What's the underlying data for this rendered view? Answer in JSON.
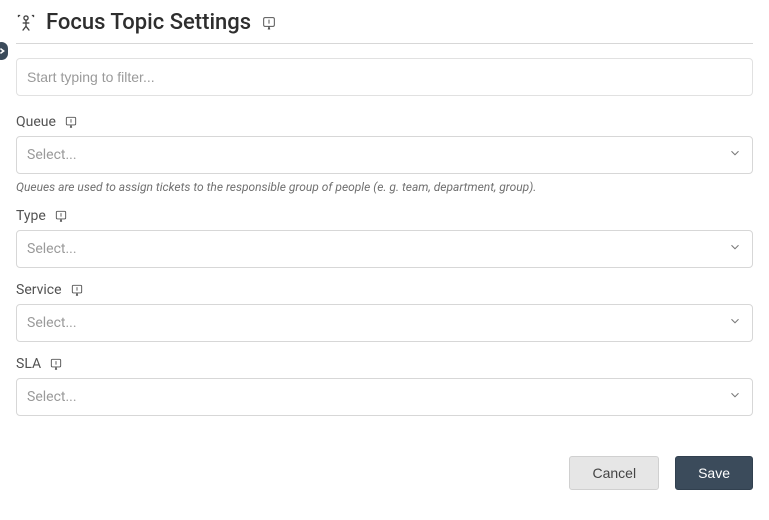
{
  "header": {
    "title": "Focus Topic Settings"
  },
  "filter": {
    "placeholder": "Start typing to filter..."
  },
  "fields": {
    "queue": {
      "label": "Queue",
      "placeholder": "Select...",
      "hint": "Queues are used to assign tickets to the responsible group of people (e. g. team, department, group)."
    },
    "type": {
      "label": "Type",
      "placeholder": "Select..."
    },
    "service": {
      "label": "Service",
      "placeholder": "Select..."
    },
    "sla": {
      "label": "SLA",
      "placeholder": "Select..."
    }
  },
  "footer": {
    "cancel": "Cancel",
    "save": "Save"
  }
}
